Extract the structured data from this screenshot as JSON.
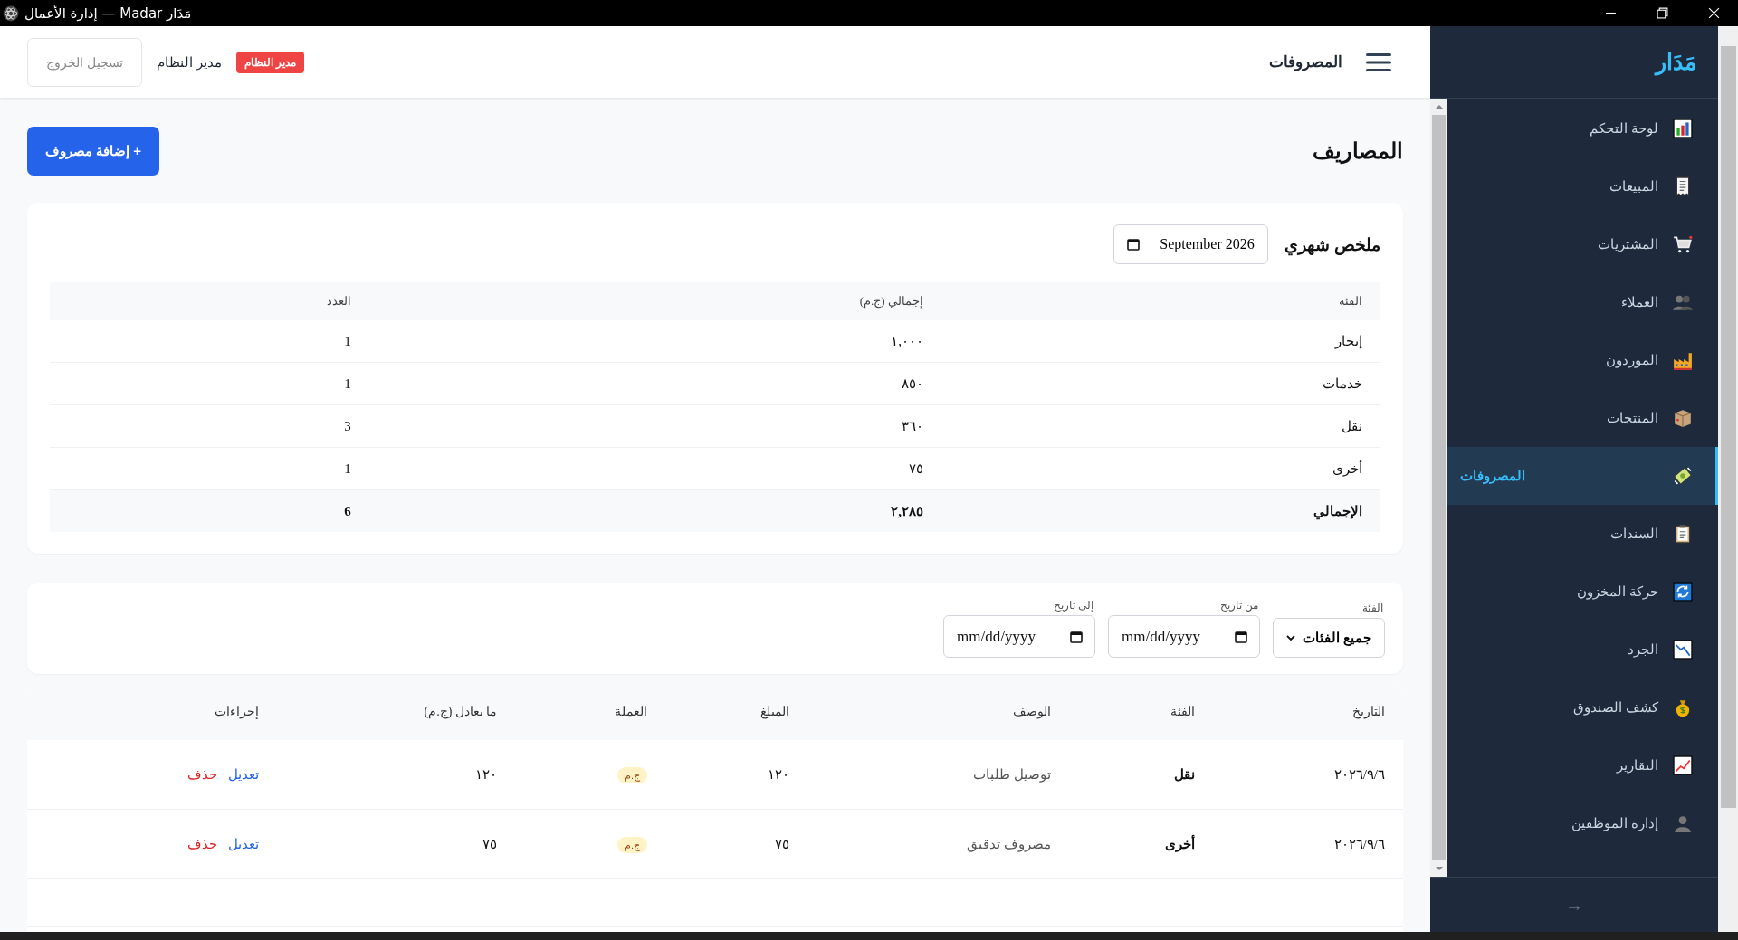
{
  "window": {
    "title": "إدارة الأعمال — Madar مَدَار"
  },
  "sidebar": {
    "logo": "مَدَار",
    "items": [
      {
        "label": "لوحة التحكم",
        "selected": false
      },
      {
        "label": "المبيعات",
        "selected": false
      },
      {
        "label": "المشتريات",
        "selected": false
      },
      {
        "label": "العملاء",
        "selected": false
      },
      {
        "label": "الموردون",
        "selected": false
      },
      {
        "label": "المنتجات",
        "selected": false
      },
      {
        "label": "المصروفات",
        "selected": true
      },
      {
        "label": "السندات",
        "selected": false
      },
      {
        "label": "حركة المخزون",
        "selected": false
      },
      {
        "label": "الجرد",
        "selected": false
      },
      {
        "label": "كشف الصندوق",
        "selected": false
      },
      {
        "label": "التقارير",
        "selected": false
      },
      {
        "label": "إدارة الموظفين",
        "selected": false
      }
    ],
    "footer": "→"
  },
  "header": {
    "title": "المصروفات",
    "user": "مدير النظام",
    "role_badge": "مدير النظام",
    "logout": "تسجيل الخروج"
  },
  "page": {
    "title": "المصاريف",
    "add_button": "+ إضافة مصروف"
  },
  "summary": {
    "title": "ملخص شهري",
    "month": "September 2026",
    "columns": [
      "الفئة",
      "إجمالي (ج.م)",
      "العدد"
    ],
    "rows": [
      [
        "إيجار",
        "١,٠٠٠",
        "1"
      ],
      [
        "خدمات",
        "٨٥٠",
        "1"
      ],
      [
        "نقل",
        "٣٦٠",
        "3"
      ],
      [
        "أخرى",
        "٧٥",
        "1"
      ]
    ],
    "total": [
      "الإجمالي",
      "٢,٢٨٥",
      "6"
    ]
  },
  "filters": [
    {
      "kind": "select",
      "label": "الفئة",
      "value": "جميع الفئات"
    },
    {
      "kind": "date",
      "label": "من تاريخ",
      "placeholder": "mm/dd/yyyy"
    },
    {
      "kind": "date",
      "label": "إلى تاريخ",
      "placeholder": "mm/dd/yyyy"
    }
  ],
  "table": {
    "columns": [
      "التاريخ",
      "الفئة",
      "الوصف",
      "المبلغ",
      "العملة",
      "ما يعادل (ج.م)",
      "إجراءات"
    ],
    "rows": [
      {
        "date": "٢٠٢٦/٩/٦",
        "category": "نقل",
        "description": "توصيل طلبات",
        "amount": "١٢٠",
        "currency": "ج.م",
        "equivalent": "١٢٠",
        "edit": "تعديل",
        "delete": "حذف"
      },
      {
        "date": "٢٠٢٦/٩/٦",
        "category": "أخرى",
        "description": "مصروف تدقيق",
        "amount": "٧٥",
        "currency": "ج.م",
        "equivalent": "٧٥",
        "edit": "تعديل",
        "delete": "حذف"
      }
    ]
  }
}
